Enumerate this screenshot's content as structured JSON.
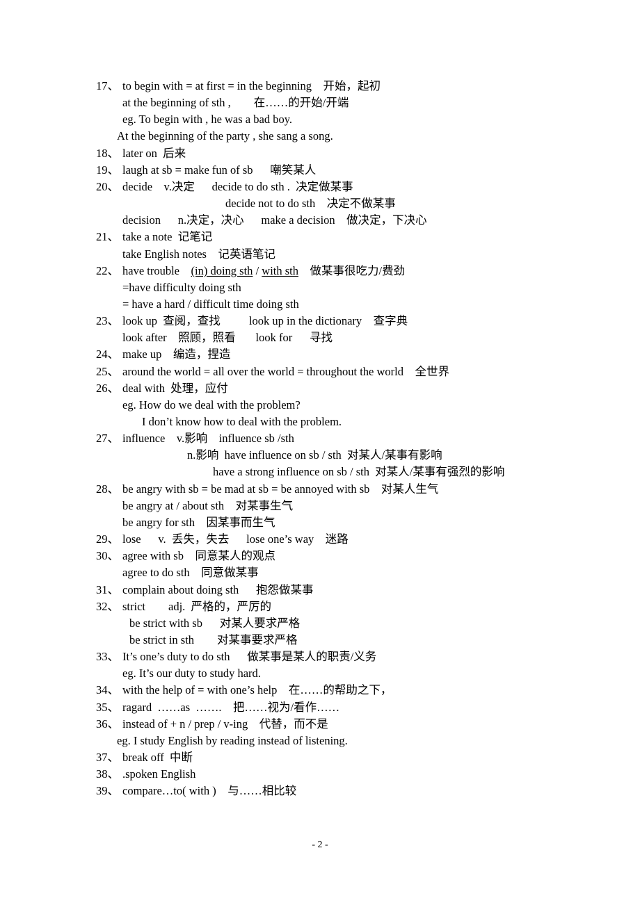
{
  "document": {
    "lines": [
      {
        "num": "17、",
        "segs": [
          {
            "t": "to begin with = at first = in the beginning    开始，起初"
          }
        ]
      },
      {
        "num": "",
        "segs": [
          {
            "t": "at the beginning of sth ,        在……的开始/开端"
          }
        ]
      },
      {
        "num": "",
        "segs": [
          {
            "t": "eg. To begin with , he was a bad boy."
          }
        ]
      },
      {
        "num": "",
        "segs": [
          {
            "t": "At the beginning of the party , she sang a song."
          }
        ]
      },
      {
        "num": "18、",
        "segs": [
          {
            "t": "later on  后来"
          }
        ]
      },
      {
        "num": "19、",
        "segs": [
          {
            "t": "laugh at sb = make fun of sb      嘲笑某人"
          }
        ]
      },
      {
        "num": "20、",
        "segs": [
          {
            "t": "decide    v.决定      decide to do sth .  决定做某事"
          }
        ]
      },
      {
        "num": "",
        "segs": [
          {
            "t": "decide not to do sth    决定不做某事"
          }
        ]
      },
      {
        "num": "",
        "segs": [
          {
            "t": "decision      n.决定，决心      make a decision    做决定，下决心"
          }
        ]
      },
      {
        "num": "21、",
        "segs": [
          {
            "t": "take a note  记笔记"
          }
        ]
      },
      {
        "num": "",
        "segs": [
          {
            "t": "take English notes    记英语笔记"
          }
        ]
      },
      {
        "num": "22、",
        "segs": [
          {
            "t": "have trouble    "
          },
          {
            "t": "(in) doing sth",
            "u": true
          },
          {
            "t": " / "
          },
          {
            "t": "with sth",
            "u": true
          },
          {
            "t": "    做某事很吃力/费劲"
          }
        ]
      },
      {
        "num": "",
        "segs": [
          {
            "t": "=have difficulty doing sth"
          }
        ]
      },
      {
        "num": "",
        "segs": [
          {
            "t": "= have a hard / difficult time doing sth"
          }
        ]
      },
      {
        "num": "23、",
        "segs": [
          {
            "t": "look up  查阅，查找          look up in the dictionary    查字典"
          }
        ]
      },
      {
        "num": "",
        "segs": [
          {
            "t": "look after    照顾，照看       look for      寻找"
          }
        ]
      },
      {
        "num": "24、",
        "segs": [
          {
            "t": "make up    编造，捏造"
          }
        ]
      },
      {
        "num": "25、",
        "segs": [
          {
            "t": "around the world = all over the world = throughout the world    全世界"
          }
        ]
      },
      {
        "num": "26、",
        "segs": [
          {
            "t": "deal with  处理，应付"
          }
        ]
      },
      {
        "num": "",
        "segs": [
          {
            "t": "eg. How do we deal with the problem?"
          }
        ]
      },
      {
        "num": "",
        "segs": [
          {
            "t": "I don’t know how to deal with the problem."
          }
        ]
      },
      {
        "num": "27、",
        "segs": [
          {
            "t": "influence    v.影响    influence sb /sth"
          }
        ]
      },
      {
        "num": "",
        "segs": [
          {
            "t": "n.影响  have influence on sb / sth  对某人/某事有影响"
          }
        ]
      },
      {
        "num": "",
        "segs": [
          {
            "t": "have a strong influence on sb / sth  对某人/某事有强烈的影响"
          }
        ]
      },
      {
        "num": "28、",
        "segs": [
          {
            "t": "be angry with sb = be mad at sb = be annoyed with sb    对某人生气"
          }
        ]
      },
      {
        "num": "",
        "segs": [
          {
            "t": "be angry at / about sth    对某事生气"
          }
        ]
      },
      {
        "num": "",
        "segs": [
          {
            "t": "be angry for sth    因某事而生气"
          }
        ]
      },
      {
        "num": "29、",
        "segs": [
          {
            "t": "lose      v.  丢失，失去      lose one’s way    迷路"
          }
        ]
      },
      {
        "num": "30、",
        "segs": [
          {
            "t": "agree with sb    同意某人的观点"
          }
        ]
      },
      {
        "num": "",
        "segs": [
          {
            "t": "agree to do sth    同意做某事"
          }
        ]
      },
      {
        "num": "31、",
        "segs": [
          {
            "t": "complain about doing sth      抱怨做某事"
          }
        ]
      },
      {
        "num": "32、",
        "segs": [
          {
            "t": "strict        adj.  严格的，严厉的"
          }
        ]
      },
      {
        "num": "",
        "segs": [
          {
            "t": "be strict with sb      对某人要求严格"
          }
        ]
      },
      {
        "num": "",
        "segs": [
          {
            "t": "be strict in sth        对某事要求严格"
          }
        ]
      },
      {
        "num": "33、",
        "segs": [
          {
            "t": "It’s one’s duty to do sth      做某事是某人的职责/义务"
          }
        ]
      },
      {
        "num": "",
        "segs": [
          {
            "t": "eg. It’s our duty to study hard."
          }
        ]
      },
      {
        "num": "34、",
        "segs": [
          {
            "t": "with the help of = with one’s help    在……的帮助之下，"
          }
        ]
      },
      {
        "num": "35、",
        "segs": [
          {
            "t": "ragard  ……as  …….    把……视为/看作……"
          }
        ]
      },
      {
        "num": "36、",
        "segs": [
          {
            "t": "instead of + n / prep / v-ing    代替，而不是"
          }
        ]
      },
      {
        "num": "",
        "segs": [
          {
            "t": "eg. I study English by reading instead of listening."
          }
        ]
      },
      {
        "num": "37、",
        "segs": [
          {
            "t": "break off  中断"
          }
        ]
      },
      {
        "num": "38、",
        "segs": [
          {
            "t": ".spoken English"
          }
        ]
      },
      {
        "num": "39、",
        "segs": [
          {
            "t": "compare…to( with )    与……相比较"
          }
        ]
      }
    ],
    "page_number": "- 2 -"
  }
}
